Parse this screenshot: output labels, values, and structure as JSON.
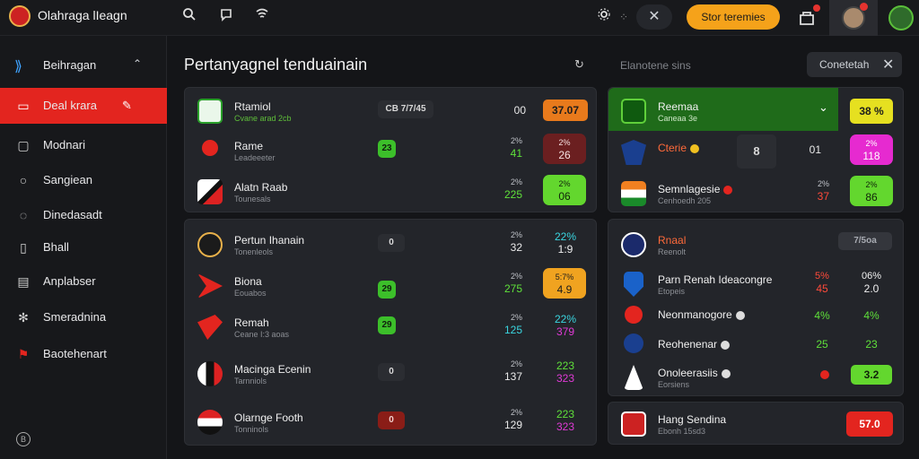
{
  "app": {
    "title": "Olahraga lIeagn"
  },
  "topbar": {
    "cta_label": "Stor teremies",
    "x_label": "✕",
    "icons": [
      "search-icon",
      "chat-icon",
      "wifi-icon",
      "settings-icon",
      "grid-icon",
      "notification-icon"
    ]
  },
  "sidebar": {
    "header": {
      "label": "Beihragan",
      "chev": "⌃"
    },
    "items": [
      {
        "label": "Deal krara",
        "icon": "tag-icon",
        "active": true
      },
      {
        "label": "Modnari",
        "icon": "monitor-icon"
      },
      {
        "label": "Sangiean",
        "icon": "search-icon"
      },
      {
        "label": "Dinedasadt",
        "icon": "chat-icon"
      },
      {
        "label": "Bhall",
        "icon": "bookmark-icon"
      },
      {
        "label": "Anplabser",
        "icon": "panel-icon"
      },
      {
        "label": "Smeradnina",
        "icon": "gear-icon"
      },
      {
        "label": "Baotehenart",
        "icon": "flag-icon"
      }
    ],
    "footer_icon": "B"
  },
  "main": {
    "title": "Pertanyagnel tenduainain",
    "refresh": "↻",
    "right_sub": "Elanotene sins",
    "right_btn": "Conetetah",
    "right_btn_x": "✕"
  },
  "panel_left_top": {
    "rows": [
      {
        "name": "Rtamiol",
        "sub": "Cvane arad 2cb",
        "pill": "CB 7/7/45",
        "mid": "00",
        "mid2": "",
        "odds": "37.07",
        "odds2": ""
      },
      {
        "name": "Rame",
        "sub": "Leadeeeter",
        "pill": "23",
        "mid": "41",
        "mid2": "2%",
        "odds": "2%",
        "odds2": "26"
      },
      {
        "name": "Alatn Raab",
        "sub": "Tounesals",
        "pill": "",
        "mid": "225",
        "mid2": "2%",
        "odds": "2%",
        "odds2": "06"
      }
    ]
  },
  "panel_left_bottom": {
    "rows": [
      {
        "name": "Pertun Ihanain",
        "sub": "Tonenleols",
        "pill": "0",
        "mid": "32",
        "mid2": "2%",
        "odds": "22%",
        "odds2": "1:9"
      },
      {
        "name": "Biona",
        "sub": "Eouabos",
        "pill": "29",
        "mid": "275",
        "mid2": "2%",
        "odds": "5:7%",
        "odds2": "4.9"
      },
      {
        "name": "Remah",
        "sub": "Ceane I:3 aoas",
        "pill": "29",
        "mid": "125",
        "mid2": "2%",
        "odds": "22%",
        "odds2": "379"
      },
      {
        "name": "Macinga Ecenin",
        "sub": "Tarnniols",
        "pill": "0",
        "mid": "137",
        "mid2": "2%",
        "odds": "223",
        "odds2": "323"
      },
      {
        "name": "Olarnge Footh",
        "sub": "Tonninols",
        "pill": "0",
        "mid": "129",
        "mid2": "2%",
        "odds": "223",
        "odds2": "323"
      }
    ]
  },
  "panel_right_top": {
    "rows": [
      {
        "name": "Reemaa",
        "sub": "Caneaa 3e",
        "odds": "38 %"
      },
      {
        "name": "Cterie",
        "sub": "",
        "score1": "8",
        "score2": "01",
        "odds": "2%",
        "odds2": "118"
      },
      {
        "name": "Semnlagesie",
        "sub": "Cenhoedh 205",
        "mid": "2%",
        "mid2": "37",
        "odds": "2%",
        "odds2": "86"
      }
    ]
  },
  "panel_right_middle": {
    "rows": [
      {
        "name": "Rnaal",
        "sub": "Reenolt",
        "pill": "7/5oa"
      },
      {
        "name": "Parn Renah Ideacongre",
        "sub": "Etopeis",
        "a": "5%",
        "a2": "45",
        "b": "06%",
        "b2": "2.0"
      },
      {
        "name": "Neonmanogore",
        "sub": "",
        "a": "4%",
        "b": "4%"
      },
      {
        "name": "Reohenenar",
        "sub": "",
        "a": "25",
        "b": "23"
      },
      {
        "name": "Onoleerasiis",
        "sub": "Eorsiens",
        "odds": "3.2"
      }
    ]
  },
  "panel_right_bottom": {
    "rows": [
      {
        "name": "Hang Sendina",
        "sub": "Ebonh 15sd3",
        "odds": "57.0"
      }
    ]
  }
}
